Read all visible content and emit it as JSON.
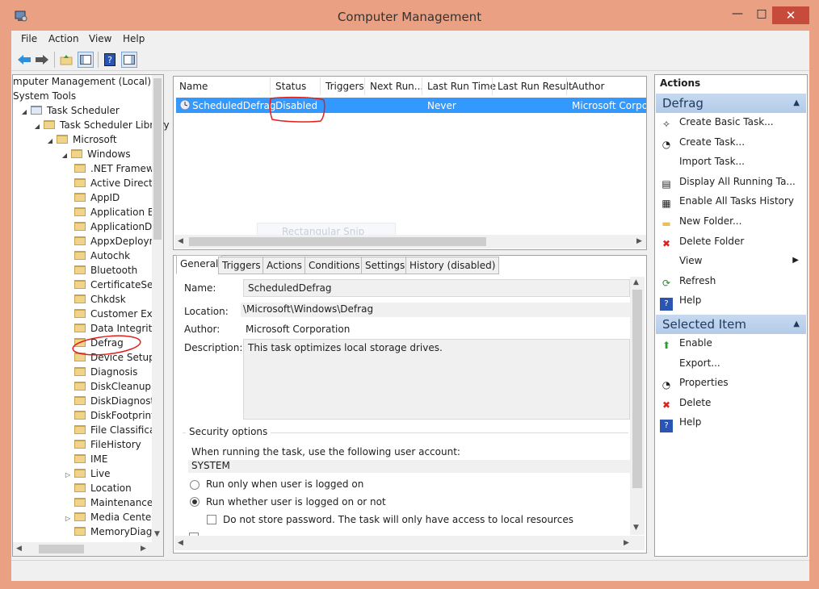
{
  "window": {
    "title": "Computer Management",
    "minimize": "—",
    "maximize": "□",
    "close": "✕"
  },
  "menu": [
    "File",
    "Action",
    "View",
    "Help"
  ],
  "tree": [
    {
      "label": "mputer Management (Local)",
      "level": 0
    },
    {
      "label": "System Tools",
      "level": 0
    },
    {
      "label": "Task Scheduler",
      "level": 1
    },
    {
      "label": "Task Scheduler Library",
      "level": 2
    },
    {
      "label": "Microsoft",
      "level": 3
    },
    {
      "label": "Windows",
      "level": 4
    },
    {
      "label": ".NET Framewo",
      "level": 5
    },
    {
      "label": "Active Directo",
      "level": 5
    },
    {
      "label": "AppID",
      "level": 5
    },
    {
      "label": "Application Ex",
      "level": 5
    },
    {
      "label": "ApplicationDa",
      "level": 5
    },
    {
      "label": "AppxDeploym",
      "level": 5
    },
    {
      "label": "Autochk",
      "level": 5
    },
    {
      "label": "Bluetooth",
      "level": 5
    },
    {
      "label": "CertificateServ",
      "level": 5
    },
    {
      "label": "Chkdsk",
      "level": 5
    },
    {
      "label": "Customer Exp",
      "level": 5
    },
    {
      "label": "Data Integrity",
      "level": 5
    },
    {
      "label": "Defrag",
      "level": 5
    },
    {
      "label": "Device Setup",
      "level": 5
    },
    {
      "label": "Diagnosis",
      "level": 5
    },
    {
      "label": "DiskCleanup",
      "level": 5
    },
    {
      "label": "DiskDiagnostic",
      "level": 5
    },
    {
      "label": "DiskFootprint",
      "level": 5
    },
    {
      "label": "File Classificat",
      "level": 5
    },
    {
      "label": "FileHistory",
      "level": 5
    },
    {
      "label": "IME",
      "level": 5
    },
    {
      "label": "Live",
      "level": 5
    },
    {
      "label": "Location",
      "level": 5
    },
    {
      "label": "Maintenance",
      "level": 5
    },
    {
      "label": "Media Center",
      "level": 5
    },
    {
      "label": "MemoryDiagn",
      "level": 5
    }
  ],
  "task_list": {
    "columns": [
      "Name",
      "Status",
      "Triggers",
      "Next Run...",
      "Last Run Time",
      "Last Run Result",
      "Author"
    ],
    "rows": [
      {
        "name": "ScheduledDefrag",
        "status": "Disabled",
        "triggers": "",
        "next_run": "",
        "last_run_time": "Never",
        "last_run_result": "",
        "author": "Microsoft Corpor"
      }
    ],
    "ghost_tooltip": "Rectangular Snip"
  },
  "tabs": [
    "General",
    "Triggers",
    "Actions",
    "Conditions",
    "Settings",
    "History (disabled)"
  ],
  "general": {
    "name_label": "Name:",
    "name_value": "ScheduledDefrag",
    "location_label": "Location:",
    "location_value": "\\Microsoft\\Windows\\Defrag",
    "author_label": "Author:",
    "author_value": "Microsoft Corporation",
    "description_label": "Description:",
    "description_value": "This task optimizes local storage drives.",
    "security_title": "Security options",
    "security_prompt": "When running the task, use the following user account:",
    "account": "SYSTEM",
    "radio1": "Run only when user is logged on",
    "radio2": "Run whether user is logged on or not",
    "checkbox1": "Do not store password.  The task will only have access to local resources",
    "radio_selected": 2
  },
  "actions": {
    "header": "Actions",
    "section1": "Defrag",
    "items1": [
      {
        "label": "Create Basic Task...",
        "icon": "wizard-icon"
      },
      {
        "label": "Create Task...",
        "icon": "task-icon"
      },
      {
        "label": "Import Task...",
        "icon": ""
      },
      {
        "label": "Display All Running Ta...",
        "icon": "running-tasks-icon"
      },
      {
        "label": "Enable All Tasks History",
        "icon": "history-icon"
      },
      {
        "label": "New Folder...",
        "icon": "folder-icon"
      },
      {
        "label": "Delete Folder",
        "icon": "delete-icon"
      },
      {
        "label": "View",
        "icon": ""
      },
      {
        "label": "Refresh",
        "icon": "refresh-icon"
      },
      {
        "label": "Help",
        "icon": "help-icon"
      }
    ],
    "section2": "Selected Item",
    "items2": [
      {
        "label": "Enable",
        "icon": "enable-arrow-icon"
      },
      {
        "label": "Export...",
        "icon": ""
      },
      {
        "label": "Properties",
        "icon": "properties-icon"
      },
      {
        "label": "Delete",
        "icon": "delete-icon"
      },
      {
        "label": "Help",
        "icon": "help-icon"
      }
    ]
  },
  "colors": {
    "selection": "#3399ff",
    "title_bar": "#e9a083",
    "annotation": "#e0201c",
    "section_header": "#c6d9f0"
  }
}
